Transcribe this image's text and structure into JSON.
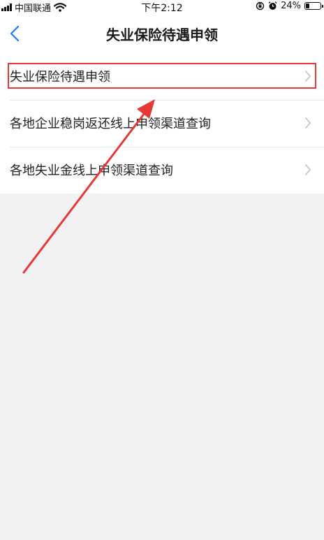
{
  "status_bar": {
    "carrier": "中国联通",
    "time": "下午2:12",
    "battery_percent": "24%",
    "battery_level": 0.24
  },
  "nav": {
    "title": "失业保险待遇申领",
    "back_icon": "chevron-left-icon"
  },
  "menu": {
    "items": [
      {
        "label": "失业保险待遇申领"
      },
      {
        "label": "各地企业稳岗返还线上申领渠道查询"
      },
      {
        "label": "各地失业金线上申领渠道查询"
      }
    ]
  },
  "colors": {
    "accent": "#1e7cf2",
    "annotation": "#e53935",
    "background": "#f2f2f4"
  }
}
